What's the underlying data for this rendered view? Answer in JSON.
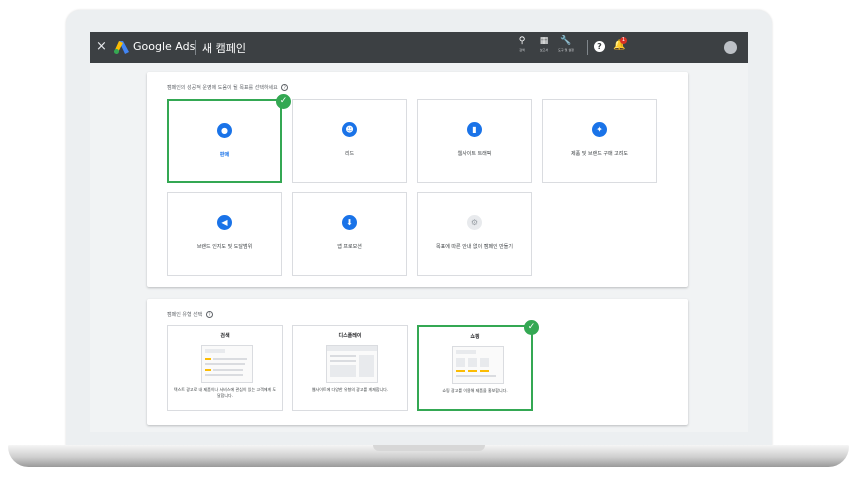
{
  "topbar": {
    "close_glyph": "×",
    "brand": "Google Ads",
    "title": "새 캠페인",
    "tools": [
      {
        "icon": "search-icon",
        "glyph": "⚲",
        "label": "검색"
      },
      {
        "icon": "reports-icon",
        "glyph": "▦",
        "label": "보고서"
      },
      {
        "icon": "wrench-icon",
        "glyph": "🔧",
        "label": "도구 및 설정"
      }
    ],
    "help_glyph": "?",
    "bell_glyph": "🔔",
    "notification_count": "1"
  },
  "goals": {
    "title": "캠페인의 성공적 운영에 도움이 될 목표를 선택하세요",
    "info_glyph": "?",
    "check_glyph": "✓",
    "items": [
      {
        "label": "판매",
        "icon": "tag-icon",
        "glyph": "●",
        "selected": true
      },
      {
        "label": "리드",
        "icon": "people-icon",
        "glyph": "☻",
        "selected": false
      },
      {
        "label": "웹사이트 트래픽",
        "icon": "mouse-icon",
        "glyph": "▮",
        "selected": false
      },
      {
        "label": "제품 및 브랜드 구매 고려도",
        "icon": "sparkle-icon",
        "glyph": "✦",
        "selected": false
      },
      {
        "label": "브랜드 인지도 및 도달범위",
        "icon": "speaker-icon",
        "glyph": "◀",
        "selected": false
      },
      {
        "label": "앱 프로모션",
        "icon": "download-icon",
        "glyph": "⬇",
        "selected": false
      },
      {
        "label": "목표에 따른 안내 없이 캠페인 만들기",
        "icon": "gear-icon",
        "glyph": "⚙",
        "selected": false
      }
    ]
  },
  "campaign_types": {
    "title": "캠페인 유형 선택",
    "info_glyph": "?",
    "check_glyph": "✓",
    "items": [
      {
        "name": "검색",
        "description": "텍스트 광고로 내 제품이나 서비스에 관심이 있는 고객에게 도달합니다.",
        "selected": false
      },
      {
        "name": "디스플레이",
        "description": "웹사이트에 다양한 유형의 광고를 게재합니다.",
        "selected": false
      },
      {
        "name": "쇼핑",
        "description": "쇼핑 광고를 이용해 제품을 홍보합니다.",
        "selected": true
      }
    ]
  },
  "colors": {
    "accent": "#1a73e8",
    "selected_border": "#34a853",
    "topbar": "#3c4043"
  }
}
